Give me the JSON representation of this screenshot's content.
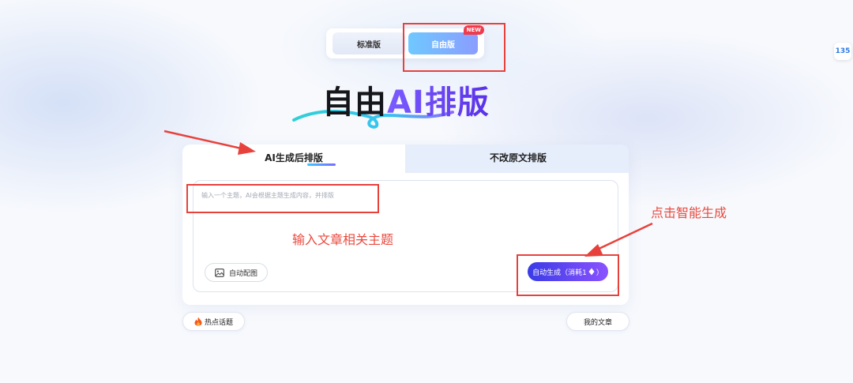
{
  "version_toggle": {
    "standard_label": "标准版",
    "free_label": "自由版",
    "new_badge": "NEW"
  },
  "side_logo_text": "135",
  "hero": {
    "title_black": "自由",
    "title_purple": "AI排版"
  },
  "tabs": {
    "ai_generate": "AI生成后排版",
    "keep_original": "不改原文排版"
  },
  "editor": {
    "placeholder": "输入一个主题，AI会根据主题生成内容，并排版",
    "value": "",
    "auto_image_label": "自动配图",
    "generate_label": "自动生成（消耗1",
    "generate_icon": "diamond-icon"
  },
  "bottom": {
    "hot_topics_label": "热点话题",
    "my_articles_label": "我的文章"
  },
  "annotations": {
    "input_hint": "输入文章相关主题",
    "click_hint": "点击智能生成"
  },
  "colors": {
    "accent_start": "#3a3ce6",
    "accent_end": "#8b52ff",
    "annotation_red": "#e8413c",
    "new_badge": "#ef3b4c"
  }
}
